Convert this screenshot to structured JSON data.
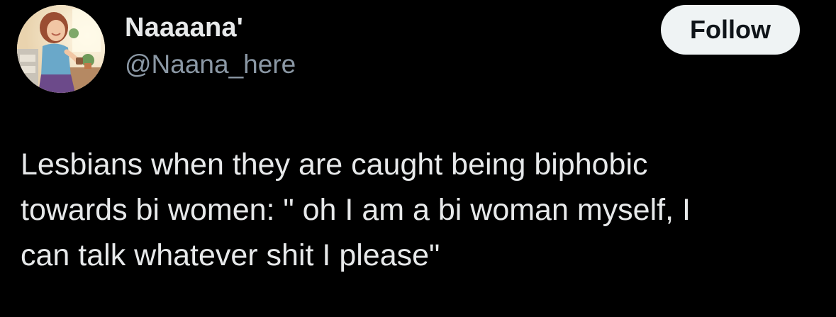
{
  "author": {
    "display_name": "Naaaana'",
    "handle": "@Naana_here",
    "avatar_icon": "avatar-illustration-woman-kitchen"
  },
  "follow_button": {
    "label": "Follow"
  },
  "tweet": {
    "lines": [
      "Lesbians when they are caught being biphobic",
      "towards bi women: \" oh I am a bi woman myself, I",
      "can talk whatever shit I please\""
    ]
  },
  "colors": {
    "background": "#000000",
    "primary_text": "#e7e9ea",
    "secondary_text": "#8b98a5",
    "button_background": "#eff3f4",
    "button_text": "#0f1419"
  }
}
